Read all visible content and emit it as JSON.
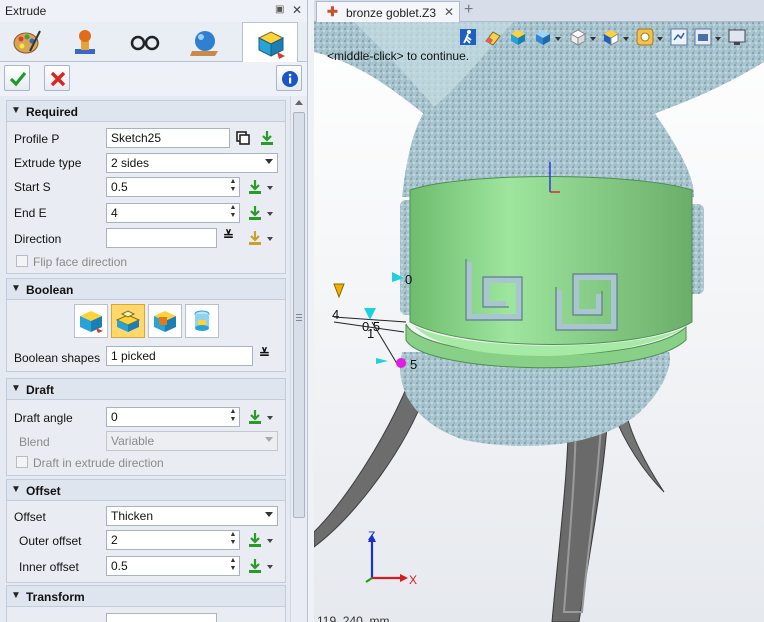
{
  "panel": {
    "title": "Extrude",
    "pin_icon": "pin-icon",
    "close_icon": "close-icon",
    "tabs": [
      {
        "name": "palette",
        "icon": "paint-palette-icon"
      },
      {
        "name": "stamp",
        "icon": "stamp-icon"
      },
      {
        "name": "glasses",
        "icon": "glasses-icon"
      },
      {
        "name": "sphere-plane",
        "icon": "sphere-on-plane-icon"
      },
      {
        "name": "extrude",
        "icon": "extrude-box-icon",
        "active": true
      }
    ],
    "actions": {
      "ok_icon": "check-icon",
      "cancel_icon": "cancel-x-icon",
      "info_icon": "info-icon"
    }
  },
  "required": {
    "header": "Required",
    "profile_label": "Profile P",
    "profile_value": "Sketch25",
    "extrude_type_label": "Extrude type",
    "extrude_type_value": "2 sides",
    "start_label": "Start S",
    "start_value": "0.5",
    "end_label": "End E",
    "end_value": "4",
    "direction_label": "Direction",
    "direction_value": "",
    "flip_label": "Flip face direction",
    "flip_checked": false
  },
  "boolean": {
    "header": "Boolean",
    "shapes_label": "Boolean shapes",
    "shapes_value": "1 picked",
    "buttons": [
      {
        "name": "base-body",
        "icon": "extrude-base-icon"
      },
      {
        "name": "add",
        "icon": "boolean-add-icon",
        "selected": true
      },
      {
        "name": "remove",
        "icon": "boolean-remove-icon"
      },
      {
        "name": "intersect",
        "icon": "boolean-intersect-icon"
      }
    ]
  },
  "draft": {
    "header": "Draft",
    "angle_label": "Draft angle",
    "angle_value": "0",
    "blend_label": "Blend",
    "blend_value": "Variable",
    "draft_in_dir_label": "Draft in extrude direction",
    "draft_in_dir_checked": false
  },
  "offset": {
    "header": "Offset",
    "offset_label": "Offset",
    "offset_value": "Thicken",
    "outer_label": "Outer offset",
    "outer_value": "2",
    "inner_label": "Inner offset",
    "inner_value": "0.5"
  },
  "transform": {
    "header": "Transform"
  },
  "document": {
    "tab_name": "bronze goblet.Z3",
    "hint": "<middle-click> to continue.",
    "coords": "119, 240, mm"
  },
  "viewport": {
    "toolbar_icons": [
      "run-icon",
      "eraser-icon",
      "box-display-icon",
      "cube-view-icon",
      "cube-wire-icon",
      "cube-iso-icon",
      "gear-render-icon",
      "fit-view-icon",
      "camera-icon"
    ],
    "axis_labels": {
      "x": "X",
      "z": "Z"
    },
    "handle_labels": [
      "0",
      "4",
      "0.5",
      "1",
      "5"
    ]
  },
  "colors": {
    "band": "#8fd88f",
    "body": "#a9c6d0",
    "legs": "#6d6d6d",
    "accent": "#d83a2a"
  }
}
